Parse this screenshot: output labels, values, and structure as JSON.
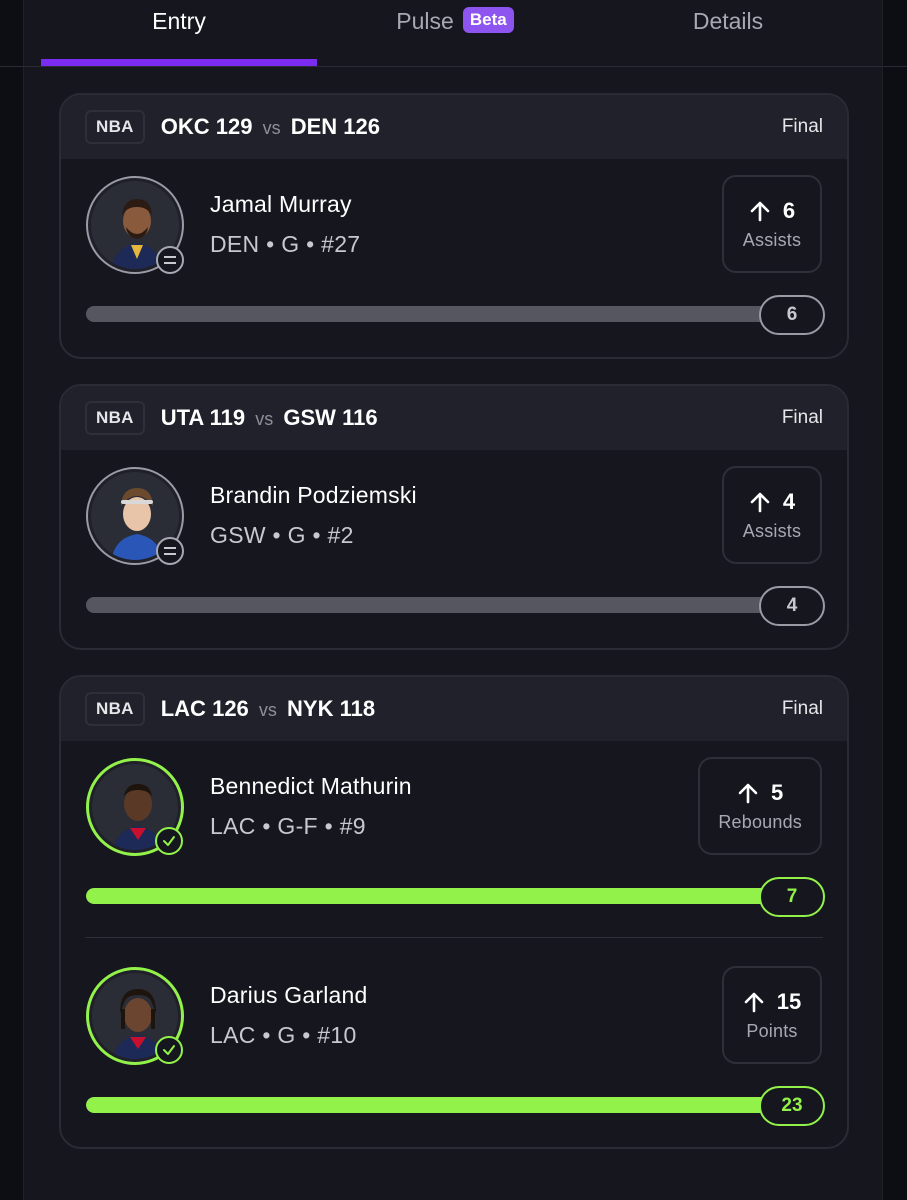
{
  "tabs": [
    {
      "label": "Entry",
      "active": true
    },
    {
      "label": "Pulse",
      "badge": "Beta",
      "active": false
    },
    {
      "label": "Details",
      "active": false
    }
  ],
  "colors": {
    "accent_purple": "#7b2cf0",
    "hit_green": "#93f24a",
    "background": "#0d0e14"
  },
  "games": [
    {
      "league": "NBA",
      "team1": "OKC",
      "score1": "129",
      "vs": "vs",
      "team2": "DEN",
      "score2": "126",
      "status": "Final",
      "players": [
        {
          "name": "Jamal Murray",
          "meta": "DEN • G • #27",
          "line": "6",
          "stat": "Assists",
          "direction": "up",
          "actual": "6",
          "progress_fraction": 1.0,
          "status_icon": "equals-icon",
          "result": "push"
        }
      ]
    },
    {
      "league": "NBA",
      "team1": "UTA",
      "score1": "119",
      "vs": "vs",
      "team2": "GSW",
      "score2": "116",
      "status": "Final",
      "players": [
        {
          "name": "Brandin Podziemski",
          "meta": "GSW • G • #2",
          "line": "4",
          "stat": "Assists",
          "direction": "up",
          "actual": "4",
          "progress_fraction": 1.0,
          "status_icon": "equals-icon",
          "result": "push"
        }
      ]
    },
    {
      "league": "NBA",
      "team1": "LAC",
      "score1": "126",
      "vs": "vs",
      "team2": "NYK",
      "score2": "118",
      "status": "Final",
      "players": [
        {
          "name": "Bennedict Mathurin",
          "meta": "LAC • G-F • #9",
          "line": "5",
          "stat": "Rebounds",
          "direction": "up",
          "actual": "7",
          "progress_fraction": 1.0,
          "status_icon": "check-icon",
          "result": "hit"
        },
        {
          "name": "Darius Garland",
          "meta": "LAC • G • #10",
          "line": "15",
          "stat": "Points",
          "direction": "up",
          "actual": "23",
          "progress_fraction": 1.0,
          "status_icon": "check-icon",
          "result": "hit"
        }
      ]
    }
  ]
}
